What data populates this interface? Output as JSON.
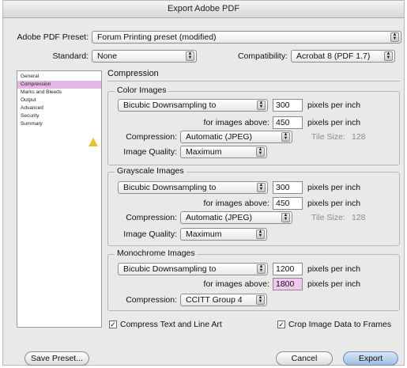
{
  "window": {
    "title": "Export Adobe PDF"
  },
  "preset": {
    "label": "Adobe PDF Preset:",
    "value": "Forum Printing preset (modified)"
  },
  "standard": {
    "label": "Standard:",
    "value": "None"
  },
  "compatibility": {
    "label": "Compatibility:",
    "value": "Acrobat 8 (PDF 1.7)"
  },
  "sidebar": {
    "items": [
      {
        "label": "General"
      },
      {
        "label": "Compression"
      },
      {
        "label": "Marks and Bleeds"
      },
      {
        "label": "Output"
      },
      {
        "label": "Advanced"
      },
      {
        "label": "Security"
      },
      {
        "label": "Summary"
      }
    ],
    "selected": "Compression",
    "warning_icon": "warning-triangle-icon"
  },
  "panel": {
    "title": "Compression"
  },
  "color_images": {
    "title": "Color Images",
    "sampling": "Bicubic Downsampling to",
    "ppi": "300",
    "ppi_unit": "pixels per inch",
    "above_label": "for images above:",
    "above": "450",
    "above_unit": "pixels per inch",
    "compression_label": "Compression:",
    "compression": "Automatic (JPEG)",
    "tile_label": "Tile Size:",
    "tile": "128",
    "quality_label": "Image Quality:",
    "quality": "Maximum"
  },
  "grayscale_images": {
    "title": "Grayscale Images",
    "sampling": "Bicubic Downsampling to",
    "ppi": "300",
    "ppi_unit": "pixels per inch",
    "above_label": "for images above:",
    "above": "450",
    "above_unit": "pixels per inch",
    "compression_label": "Compression:",
    "compression": "Automatic (JPEG)",
    "tile_label": "Tile Size:",
    "tile": "128",
    "quality_label": "Image Quality:",
    "quality": "Maximum"
  },
  "mono_images": {
    "title": "Monochrome Images",
    "sampling": "Bicubic Downsampling to",
    "ppi": "1200",
    "ppi_unit": "pixels per inch",
    "above_label": "for images above:",
    "above": "1800",
    "above_unit": "pixels per inch",
    "compression_label": "Compression:",
    "compression": "CCITT Group 4"
  },
  "options": {
    "compress_text": {
      "label": "Compress Text and Line Art",
      "checked": true
    },
    "crop_image": {
      "label": "Crop Image Data to Frames",
      "checked": true
    }
  },
  "buttons": {
    "save_preset": "Save Preset...",
    "cancel": "Cancel",
    "export": "Export"
  }
}
